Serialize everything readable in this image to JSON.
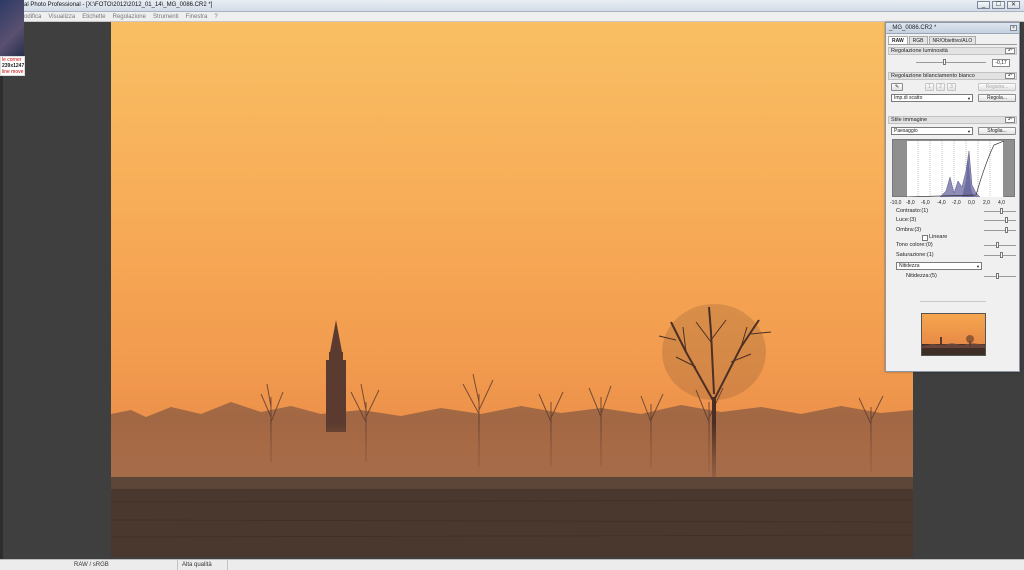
{
  "window": {
    "title": "al Photo Professional - [X:\\FOTO\\2012\\2012_01_14\\_MG_0086.CR2 *]",
    "controls": [
      "_",
      "☐",
      "✕"
    ]
  },
  "menu": [
    "odifica",
    "Visualizza",
    "Etichette",
    "Regolazione",
    "Strumenti",
    "Finestra",
    "?"
  ],
  "overlay": {
    "line1": "le corner",
    "line2": "239x1247",
    "line3": "line move"
  },
  "status": {
    "color_space": "RAW / sRGB",
    "quality": "Alta qualità"
  },
  "palette": {
    "title": "_MG_0086.CR2 *",
    "close": "×",
    "tabs": [
      "RAW",
      "RGB",
      "NR/Obiettivo/ALO"
    ],
    "active_tab": "RAW",
    "brightness": {
      "header": "Regolazione luminosità",
      "value": "-0,17",
      "reset": "↶"
    },
    "white_balance": {
      "header": "Regolazione bilanciamento bianco",
      "reset": "↶",
      "eyedropper": "✎",
      "presets": [
        "1",
        "2",
        "3"
      ],
      "register": "Registra...",
      "mode": "Imp.di scatto",
      "adjust": "Regola..."
    },
    "picture_style": {
      "header": "Stile immagine",
      "reset": "↶",
      "style": "Paesaggio",
      "browse": "Sfoglia..."
    },
    "histogram_axis": [
      "-10,0",
      "-8,0",
      "-6,0",
      "-4,0",
      "-2,0",
      "0,0",
      "2,0",
      "4,0"
    ],
    "tone": {
      "contrast": "Contrasto:(1)",
      "highlight": "Luce:(3)",
      "shadow": "Ombra:(3)",
      "linear": "Lineare",
      "color_tone": "Tono colore:(0)",
      "saturation": "Saturazione:(1)",
      "sharpness_mode": "Nitidezza",
      "sharpness": "Nitidezza:(5)"
    },
    "slider_levels": {
      "brightness": -0.17,
      "contrast": 1,
      "highlight": 3,
      "shadow": 3,
      "color_tone": 0,
      "saturation": 1,
      "sharpness": 5
    }
  }
}
